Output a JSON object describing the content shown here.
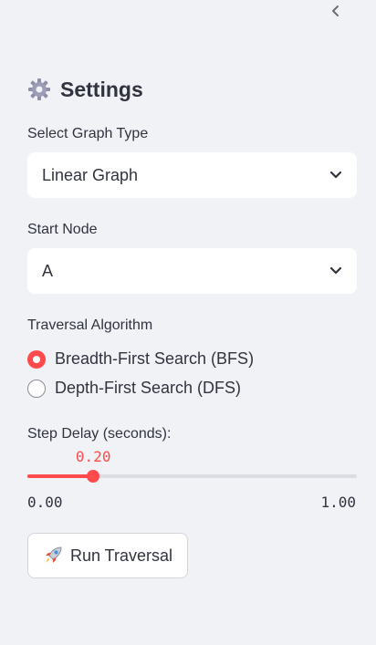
{
  "sidebar": {
    "collapse_icon": "chevron-left-icon",
    "header": {
      "icon": "gear-icon",
      "title": "Settings"
    },
    "graph_type": {
      "label": "Select Graph Type",
      "value": "Linear Graph"
    },
    "start_node": {
      "label": "Start Node",
      "value": "A"
    },
    "algorithm": {
      "label": "Traversal Algorithm",
      "options": [
        {
          "label": "Breadth-First Search (BFS)",
          "selected": true
        },
        {
          "label": "Depth-First Search (DFS)",
          "selected": false
        }
      ]
    },
    "step_delay": {
      "label": "Step Delay (seconds):",
      "value": "0.20",
      "min": "0.00",
      "max": "1.00",
      "fraction": 0.2
    },
    "run_button": {
      "icon": "rocket-icon",
      "label": "Run Traversal"
    }
  },
  "colors": {
    "accent": "#ff4b4b",
    "background": "#f0f2f6",
    "text": "#31333f",
    "track": "#dcdde2"
  }
}
